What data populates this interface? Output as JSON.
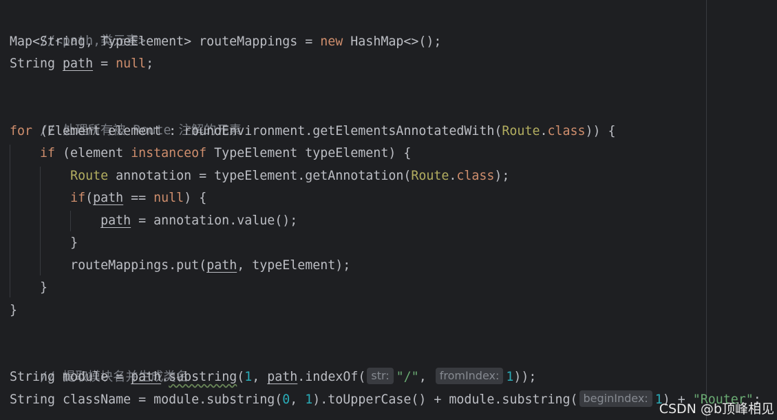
{
  "code": {
    "l1": {
      "comment": "//<path,类元素>"
    },
    "l2": {
      "a": "Map<String, TypeElement> routeMappings = ",
      "kw": "new",
      "b": " HashMap<>();"
    },
    "l3": {
      "a": "String ",
      "var": "path",
      "b": " = ",
      "kw": "null",
      "c": ";"
    },
    "l4": {
      "comment": "// 处理所有被 Route 注解的元素"
    },
    "l5": {
      "kw": "for",
      "a": " (Element element : roundEnvironment.getElementsAnnotatedWith(",
      "cls": "Route",
      "dot": ".",
      "kw2": "class",
      "b": ")) {"
    },
    "l6": {
      "indent": "    ",
      "kw": "if",
      "a": " (element ",
      "kw2": "instanceof",
      "b": " TypeElement typeElement) {"
    },
    "l7": {
      "indent": "        ",
      "cls": "Route",
      "a": " annotation = typeElement.getAnnotation(",
      "cls2": "Route",
      "dot": ".",
      "kw": "class",
      "b": ");"
    },
    "l8": {
      "indent": "        ",
      "kw": "if",
      "a": "(",
      "var": "path",
      "b": " == ",
      "kw2": "null",
      "c": ") {"
    },
    "l9": {
      "indent": "            ",
      "var": "path",
      "a": " = annotation.value();"
    },
    "l10": {
      "indent": "        ",
      "a": "}"
    },
    "l11": {
      "indent": "        ",
      "a": "routeMappings.put(",
      "var": "path",
      "b": ", typeElement);"
    },
    "l12": {
      "indent": "    ",
      "a": "}"
    },
    "l13": {
      "a": "}"
    },
    "l14": {
      "comment": "// 提取模块名并生成类名"
    },
    "l15": {
      "a": "String module = ",
      "var": "path",
      "dot": ".",
      "method": "substring",
      "b": "(",
      "num": "1",
      "c": ", ",
      "var2": "path",
      "d": ".indexOf(",
      "hint1": "str:",
      "str": "\"/\"",
      "e": ", ",
      "hint2": "fromIndex:",
      "num2": "1",
      "f": "));"
    },
    "l16": {
      "a": "String className = module.substring(",
      "num": "0",
      "b": ", ",
      "num2": "1",
      "c": ").toUpperCase() + module.substring(",
      "hint": "beginIndex:",
      "num3": "1",
      "d": ") + ",
      "str": "\"Router\"",
      "e": ";"
    }
  },
  "watermark": "CSDN @b顶峰相见",
  "colors": {
    "background": "#1e1f22",
    "keyword": "#cf8e6d",
    "class_ref": "#b3ae60",
    "number": "#2aacb8",
    "string": "#6aab73",
    "comment": "#7a7e85",
    "text": "#bcbec4"
  }
}
